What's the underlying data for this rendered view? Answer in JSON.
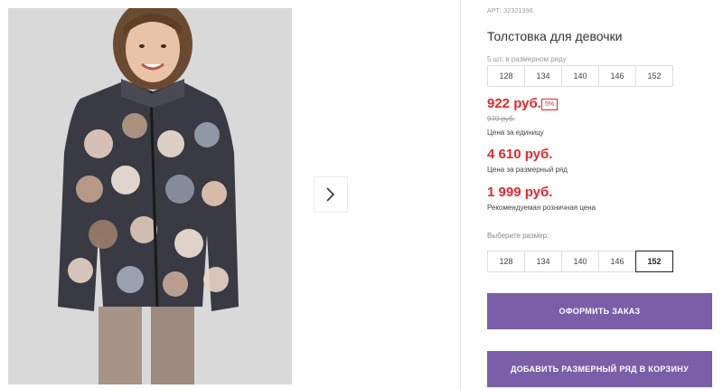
{
  "product": {
    "article": "АРТ: 32321396",
    "title": "Толстовка для девочки"
  },
  "pack": {
    "label": "5 шт. в размерном ряду",
    "sizes": [
      "128",
      "134",
      "140",
      "146",
      "152"
    ]
  },
  "prices": {
    "unit_price": "922 руб.",
    "discount": "5%",
    "old_price": "970 руб.",
    "unit_label": "Цена за единицу",
    "pack_price": "4 610 руб.",
    "pack_label": "Цена за размерный ряд",
    "retail_price": "1 999 руб.",
    "retail_label": "Рекомендуемая розничная цена"
  },
  "size_select": {
    "label": "Выберите размер:",
    "sizes": [
      "128",
      "134",
      "140",
      "146",
      "152"
    ],
    "selected": "152"
  },
  "buttons": {
    "order": "ОФОРМИТЬ ЗАКАЗ",
    "add_pack": "ДОБАВИТЬ РАЗМЕРНЫЙ РЯД В КОРЗИНУ"
  },
  "colors": {
    "accent": "#7b5ea7",
    "price": "#e3262e"
  },
  "icons": {
    "gallery_next": "chevron-right-icon"
  }
}
